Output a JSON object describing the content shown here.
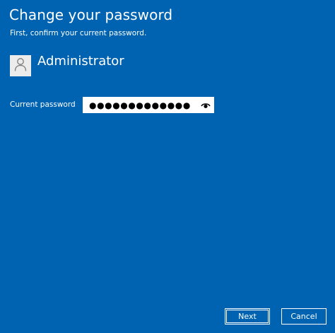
{
  "dialog": {
    "title": "Change your password",
    "subtitle": "First, confirm your current password."
  },
  "account": {
    "name": "Administrator",
    "avatar_icon": "user-icon"
  },
  "password_field": {
    "label": "Current password",
    "masked_value": "●●●●●●●●●●●●●",
    "reveal_icon": "eye-icon"
  },
  "buttons": {
    "next_label": "Next",
    "cancel_label": "Cancel"
  },
  "colors": {
    "background": "#0063b1",
    "text": "#ffffff",
    "avatar_bg": "#ececec"
  }
}
